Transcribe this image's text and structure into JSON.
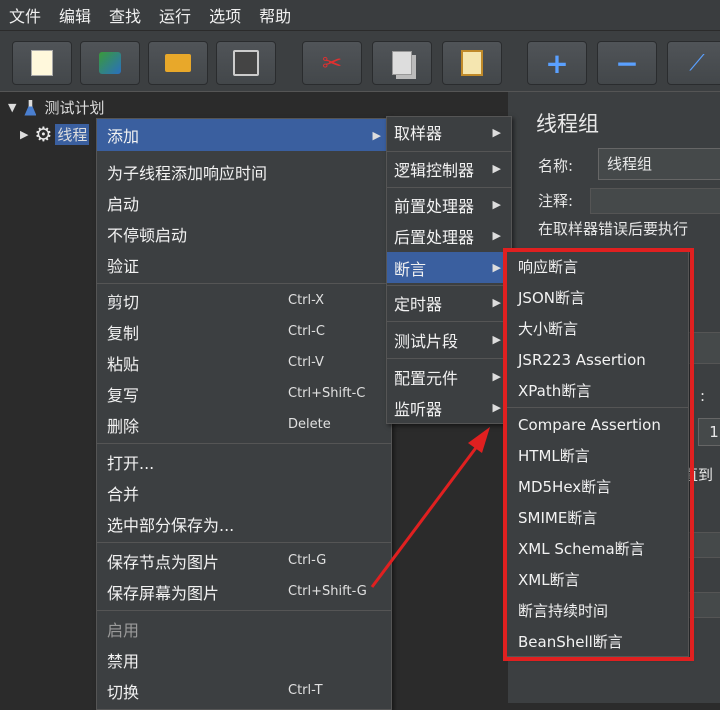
{
  "menubar": {
    "items": [
      "文件",
      "编辑",
      "查找",
      "运行",
      "选项",
      "帮助"
    ]
  },
  "toolbar": {
    "buttons": [
      {
        "name": "new-button",
        "icon": "new-icon",
        "glyph": "🗋"
      },
      {
        "name": "templates-button",
        "icon": "templates-icon",
        "glyph": "▦"
      },
      {
        "name": "open-button",
        "icon": "open-icon",
        "glyph": "📂"
      },
      {
        "name": "save-button",
        "icon": "save-icon",
        "glyph": "💾"
      },
      {
        "name": "cut-button",
        "icon": "cut-icon",
        "glyph": "✂"
      },
      {
        "name": "copy-button",
        "icon": "copy-icon",
        "glyph": "❐"
      },
      {
        "name": "paste-button",
        "icon": "paste-icon",
        "glyph": "📋"
      },
      {
        "name": "expand-button",
        "icon": "plus-icon",
        "glyph": "+"
      },
      {
        "name": "collapse-button",
        "icon": "minus-icon",
        "glyph": "−"
      },
      {
        "name": "toggle-button",
        "icon": "toggle-icon",
        "glyph": "⟋"
      }
    ]
  },
  "tree": {
    "root": "测试计划",
    "child": "线程"
  },
  "panel": {
    "title": "线程组",
    "name_label": "名称:",
    "name_value": "线程组",
    "comment_label": "注释:",
    "error_label": "在取样器错误后要执行",
    "frag1": ":",
    "frag2": "直到",
    "frag3": "1"
  },
  "context_menu": {
    "add": "添加",
    "items1": [
      "为子线程添加响应时间",
      "启动",
      "不停顿启动",
      "验证"
    ],
    "items2": [
      {
        "label": "剪切",
        "shortcut": "Ctrl-X"
      },
      {
        "label": "复制",
        "shortcut": "Ctrl-C"
      },
      {
        "label": "粘贴",
        "shortcut": "Ctrl-V"
      },
      {
        "label": "复写",
        "shortcut": "Ctrl+Shift-C"
      },
      {
        "label": "删除",
        "shortcut": "Delete"
      }
    ],
    "items3": [
      "打开...",
      "合并",
      "选中部分保存为..."
    ],
    "items4": [
      {
        "label": "保存节点为图片",
        "shortcut": "Ctrl-G"
      },
      {
        "label": "保存屏幕为图片",
        "shortcut": "Ctrl+Shift-G"
      }
    ],
    "items5": [
      {
        "label": "启用",
        "shortcut": ""
      },
      {
        "label": "禁用",
        "shortcut": ""
      },
      {
        "label": "切换",
        "shortcut": "Ctrl-T"
      }
    ]
  },
  "submenu": {
    "items": [
      "取样器",
      "逻辑控制器",
      "前置处理器",
      "后置处理器",
      "断言",
      "定时器",
      "测试片段",
      "配置元件",
      "监听器"
    ]
  },
  "assertions": {
    "group1": [
      "响应断言",
      "JSON断言",
      "大小断言",
      "JSR223 Assertion",
      "XPath断言"
    ],
    "group2": [
      "Compare Assertion",
      "HTML断言",
      "MD5Hex断言",
      "SMIME断言",
      "XML Schema断言",
      "XML断言",
      "断言持续时间",
      "BeanShell断言"
    ]
  },
  "colors": {
    "highlight": "#3a5f9f",
    "annotation": "#e02020"
  }
}
